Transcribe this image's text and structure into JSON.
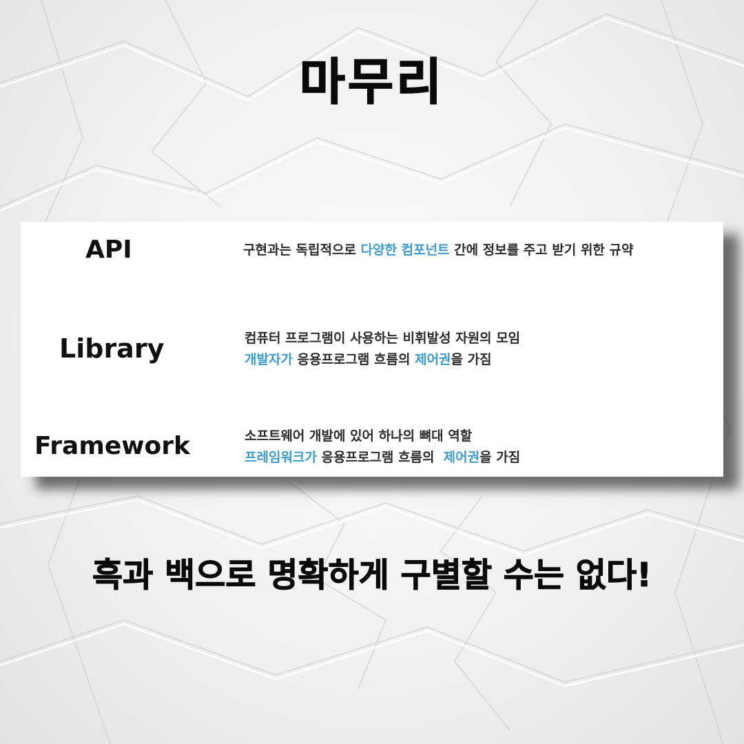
{
  "title": "마무리",
  "definitions": {
    "api": {
      "term": "API",
      "line1": {
        "pre": "구현과는 독립적으로 ",
        "highlight": "다양한 컴포넌트",
        "post": " 간에 정보를 주고 받기 위한 규약"
      }
    },
    "library": {
      "term": "Library",
      "line1": "컴퓨터 프로그램이 사용하는 비휘발성 자원의 모임",
      "line2": {
        "highlight1": "개발자가",
        "mid": " 응용프로그램 흐름의 ",
        "highlight2": "제어권",
        "post": "을 가짐"
      }
    },
    "framework": {
      "term": "Framework",
      "line1": "소프트웨어 개발에 있어 하나의 뼈대 역할",
      "line2": {
        "highlight1": "프레임워크가",
        "mid": " 응용프로그램 흐름의  ",
        "highlight2": "제어권",
        "post": "을 가짐"
      }
    }
  },
  "footer": "흑과 백으로 명확하게 구별할 수는 없다!",
  "colors": {
    "highlight": "#3b9bd0",
    "text": "#2a2a2a",
    "heading": "#0a0a0a"
  }
}
